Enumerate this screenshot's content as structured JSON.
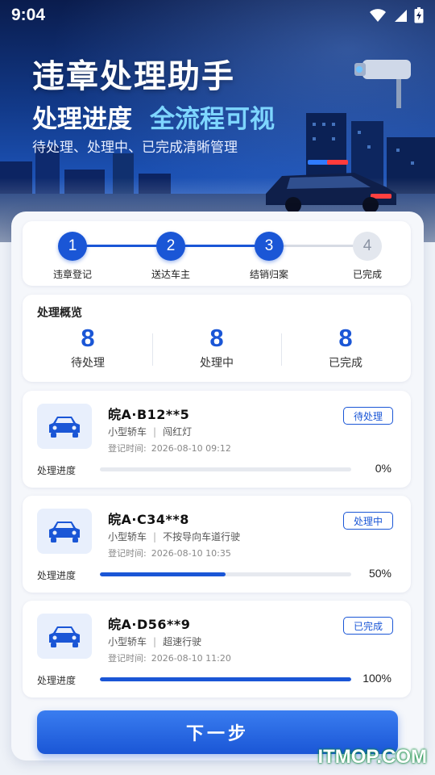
{
  "status_bar": {
    "time": "9:04"
  },
  "hero": {
    "title": "违章处理助手",
    "subtitle_a": "处理进度",
    "subtitle_b": "全流程可视",
    "description": "待处理、处理中、已完成清晰管理"
  },
  "steps": [
    {
      "number": "1",
      "label": "违章登记",
      "active": true
    },
    {
      "number": "2",
      "label": "送达车主",
      "active": true
    },
    {
      "number": "3",
      "label": "结销归案",
      "active": true
    },
    {
      "number": "4",
      "label": "已完成",
      "active": false
    }
  ],
  "overview": {
    "title": "处理概览",
    "items": [
      {
        "count": "8",
        "label": "待处理"
      },
      {
        "count": "8",
        "label": "处理中"
      },
      {
        "count": "8",
        "label": "已完成"
      }
    ]
  },
  "records": [
    {
      "plate": "皖A·B12**5",
      "vehicle_type": "小型轿车",
      "violation": "闯红灯",
      "reg_label": "登记时间:",
      "reg_time": "2026-08-10  09:12",
      "status": "待处理",
      "progress_label": "处理进度",
      "progress": 0,
      "progress_text": "0%"
    },
    {
      "plate": "皖A·C34**8",
      "vehicle_type": "小型轿车",
      "violation": "不按导向车道行驶",
      "reg_label": "登记时间:",
      "reg_time": "2026-08-10  10:35",
      "status": "处理中",
      "progress_label": "处理进度",
      "progress": 50,
      "progress_text": "50%"
    },
    {
      "plate": "皖A·D56**9",
      "vehicle_type": "小型轿车",
      "violation": "超速行驶",
      "reg_label": "登记时间:",
      "reg_time": "2026-08-10  11:20",
      "status": "已完成",
      "progress_label": "处理进度",
      "progress": 100,
      "progress_text": "100%"
    }
  ],
  "next_button": "下一步",
  "watermark": "ITMOP.COM",
  "colors": {
    "accent": "#1a56d6",
    "hero_dark": "#0a1c4d",
    "highlight": "#7ed6ff"
  },
  "icons": {
    "signal": "wifi-icon",
    "battery": "battery-charging-icon",
    "car": "car-icon"
  }
}
